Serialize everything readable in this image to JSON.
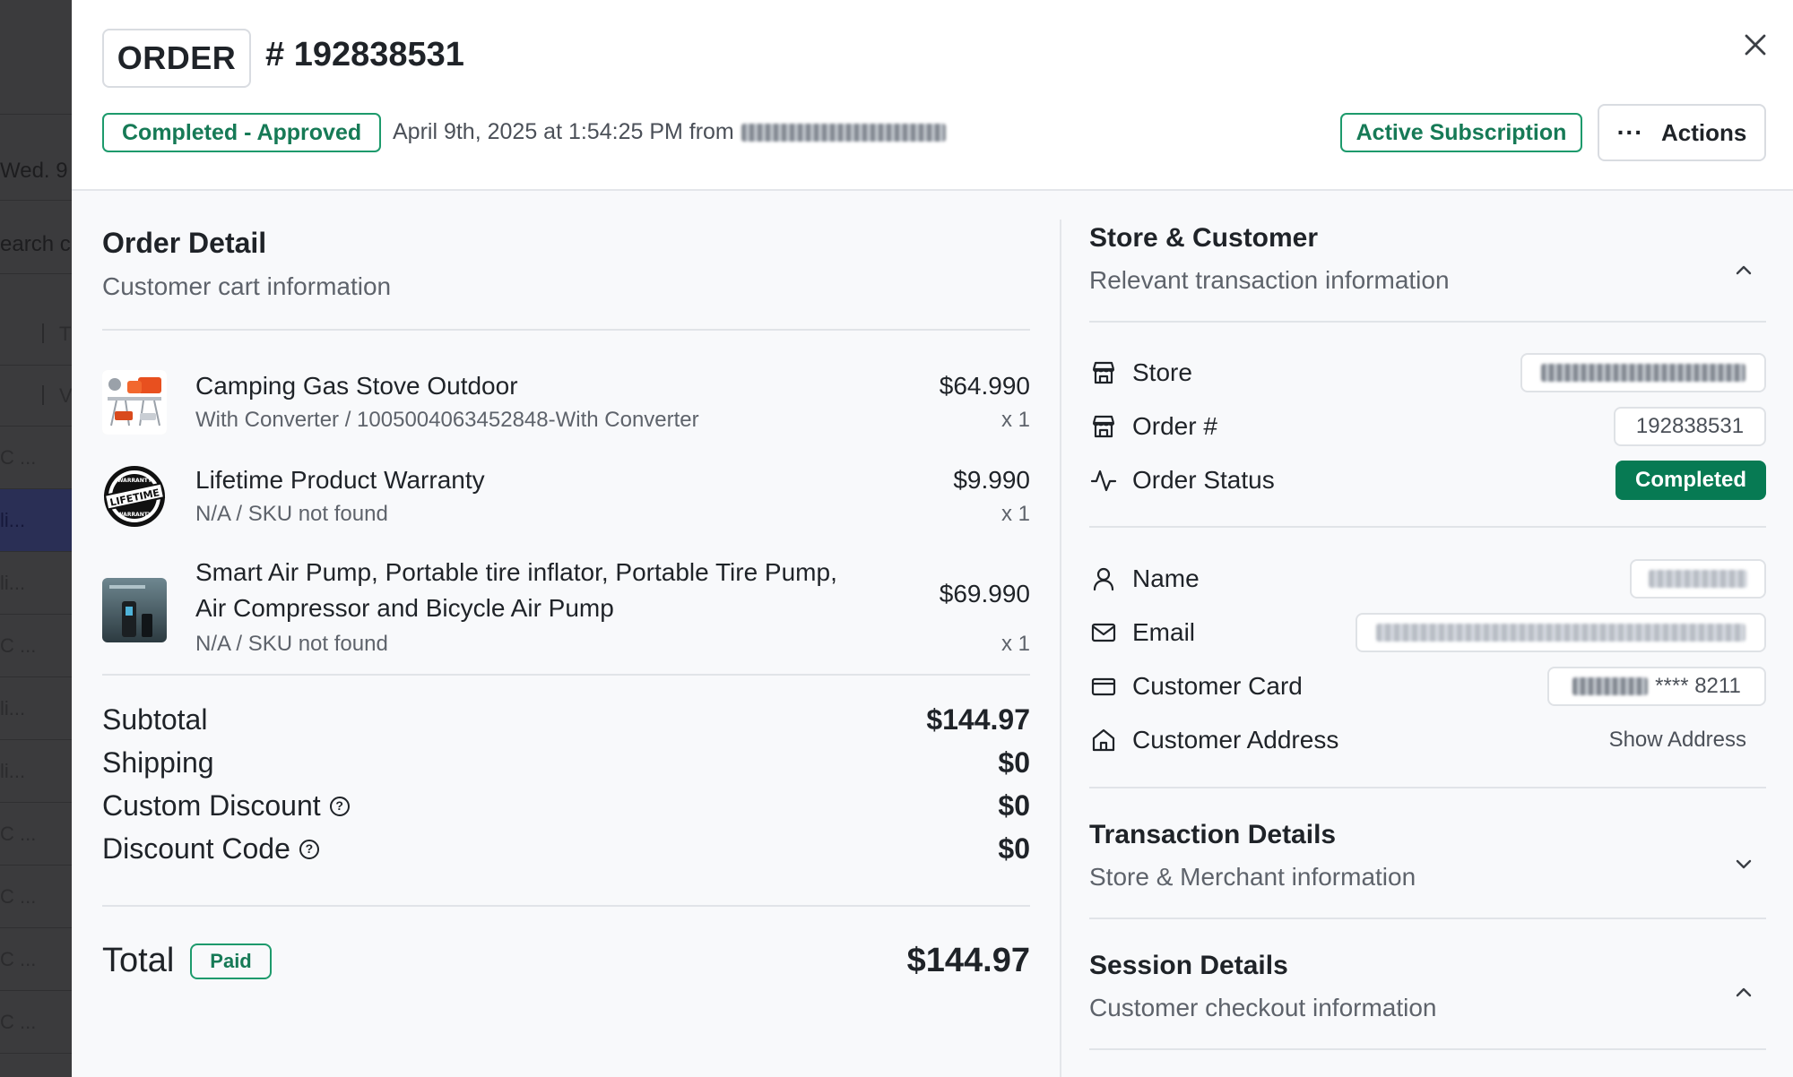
{
  "background": {
    "rows": [
      "",
      "",
      "Wed. 9",
      "earch c",
      "T",
      "V",
      "C ...",
      "li...",
      "li...",
      "C ...",
      "li...",
      "li...",
      "C ...",
      "C ...",
      "C ...",
      "C ..."
    ]
  },
  "header": {
    "order_label": "ORDER",
    "order_number": "# 192838531",
    "status": "Completed - Approved",
    "date_text": "April 9th, 2025 at 1:54:25 PM from",
    "subscription": "Active Subscription",
    "actions_label": "Actions"
  },
  "order_detail": {
    "title": "Order Detail",
    "subtitle": "Customer cart information",
    "items": [
      {
        "name": "Camping Gas Stove Outdoor",
        "meta": "With Converter / 1005004063452848-With Converter",
        "price": "$64.990",
        "qty": "x 1",
        "thumb": "gas-stove-thumbnail"
      },
      {
        "name": "Lifetime Product Warranty",
        "meta": "N/A / SKU not found",
        "price": "$9.990",
        "qty": "x 1",
        "thumb": "lifetime-warranty-badge",
        "badge_top": "WARRANTY",
        "badge_mid": "LIFETIME",
        "badge_bottom": "WARRANTY"
      },
      {
        "name_line1": "Smart Air Pump, Portable tire inflator, Portable Tire Pump,",
        "name_line2": "Air Compressor and Bicycle Air Pump",
        "meta": "N/A / SKU not found",
        "price": "$69.990",
        "qty": "x 1",
        "thumb": "air-pump-thumbnail"
      }
    ],
    "summary": {
      "subtotal_label": "Subtotal",
      "subtotal": "$144.97",
      "shipping_label": "Shipping",
      "shipping": "$0",
      "custom_discount_label": "Custom Discount",
      "custom_discount": "$0",
      "discount_code_label": "Discount Code",
      "discount_code": "$0"
    },
    "total_label": "Total",
    "paid_label": "Paid",
    "total": "$144.97"
  },
  "store_customer": {
    "title": "Store & Customer",
    "subtitle": "Relevant transaction information",
    "store_label": "Store",
    "order_label": "Order #",
    "order_value": "192838531",
    "status_label": "Order Status",
    "status_value": "Completed",
    "name_label": "Name",
    "email_label": "Email",
    "card_label": "Customer Card",
    "card_suffix": "**** 8211",
    "address_label": "Customer Address",
    "address_action": "Show Address"
  },
  "transaction_details": {
    "title": "Transaction Details",
    "subtitle": "Store & Merchant information"
  },
  "session_details": {
    "title": "Session Details",
    "subtitle": "Customer checkout information"
  },
  "colors": {
    "accent_green": "#1d9a6c",
    "completed_green": "#077a53"
  }
}
